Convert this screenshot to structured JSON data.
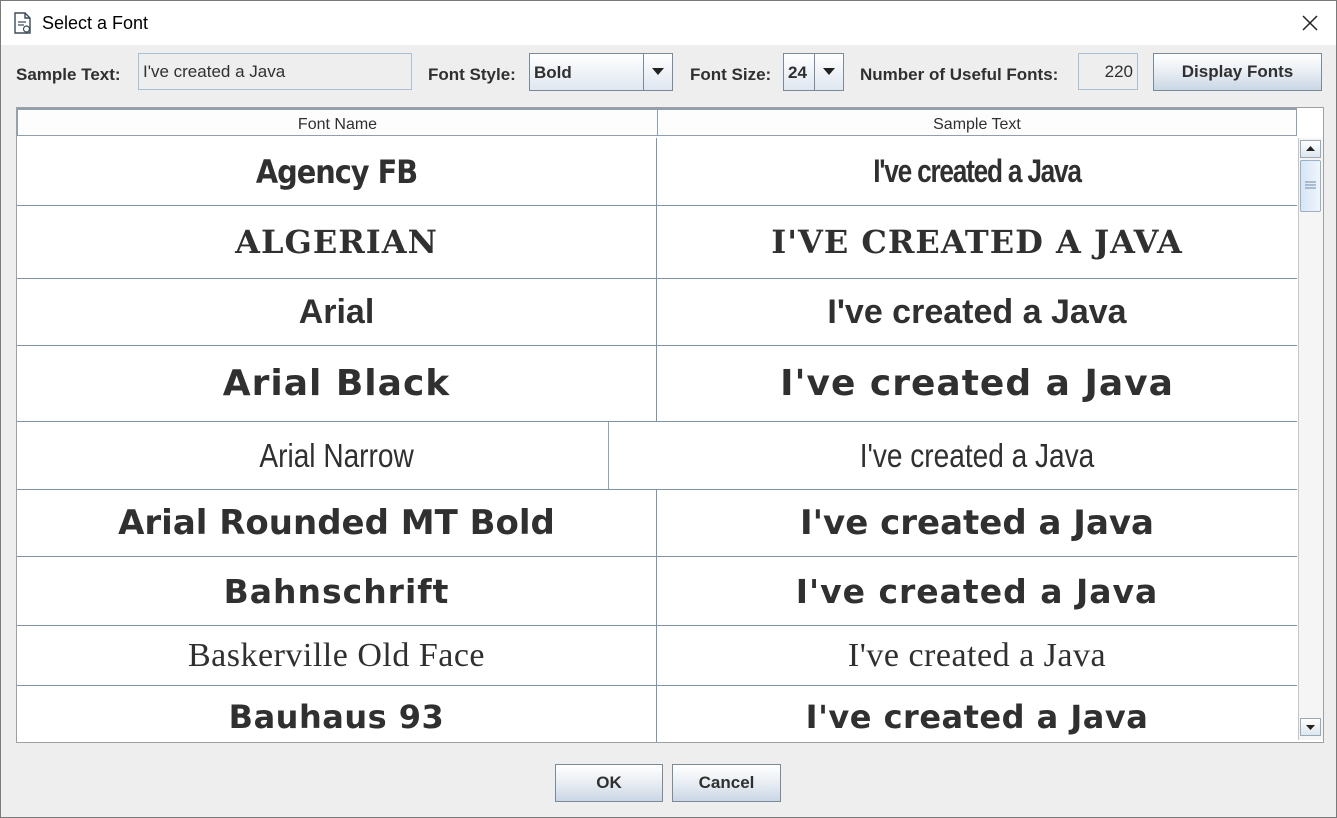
{
  "window": {
    "title": "Select a Font"
  },
  "toolbar": {
    "sample_text_label": "Sample Text:",
    "sample_text_value": "I've created a Java",
    "font_style_label": "Font Style:",
    "font_style_value": "Bold",
    "font_size_label": "Font Size:",
    "font_size_value": "24",
    "useful_fonts_label": "Number of Useful Fonts:",
    "useful_fonts_value": "220",
    "display_fonts_label": "Display Fonts"
  },
  "table": {
    "columns": [
      "Font Name",
      "Sample Text"
    ],
    "rows": [
      {
        "font_name": "Agency FB",
        "sample": "I've created a Java"
      },
      {
        "font_name": "ALGERIAN",
        "sample": "I'VE CREATED A JAVA"
      },
      {
        "font_name": "Arial",
        "sample": "I've created a Java"
      },
      {
        "font_name": "Arial Black",
        "sample": "I've created a Java"
      },
      {
        "font_name": "Arial Narrow",
        "sample": "I've created a Java"
      },
      {
        "font_name": "Arial Rounded MT Bold",
        "sample": "I've created a Java"
      },
      {
        "font_name": "Bahnschrift",
        "sample": "I've created a Java"
      },
      {
        "font_name": "Baskerville Old Face",
        "sample": "I've created a Java"
      },
      {
        "font_name": "Bauhaus 93",
        "sample": "I've created a Java"
      }
    ]
  },
  "footer": {
    "ok_label": "OK",
    "cancel_label": "Cancel"
  }
}
